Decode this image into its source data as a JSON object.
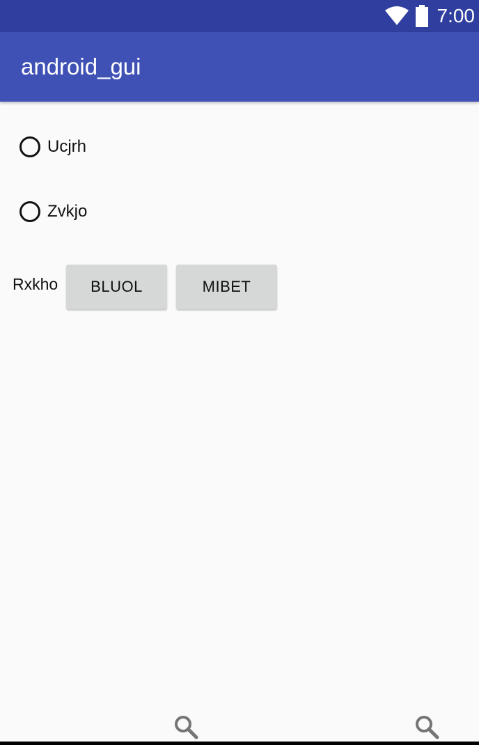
{
  "status_bar": {
    "time": "7:00",
    "wifi_icon": "wifi-icon",
    "battery_icon": "battery-icon",
    "color": "#303f9f"
  },
  "app_bar": {
    "title": "android_gui",
    "color": "#3f51b5"
  },
  "radios": [
    {
      "label": "Ucjrh",
      "checked": false
    },
    {
      "label": "Zvkjo",
      "checked": false
    }
  ],
  "button_row": {
    "label": "Rxkho",
    "buttons": [
      {
        "label": "BLUOL"
      },
      {
        "label": "MIBET"
      }
    ]
  },
  "bottom": {
    "icons": [
      "search-icon",
      "search-icon"
    ]
  }
}
